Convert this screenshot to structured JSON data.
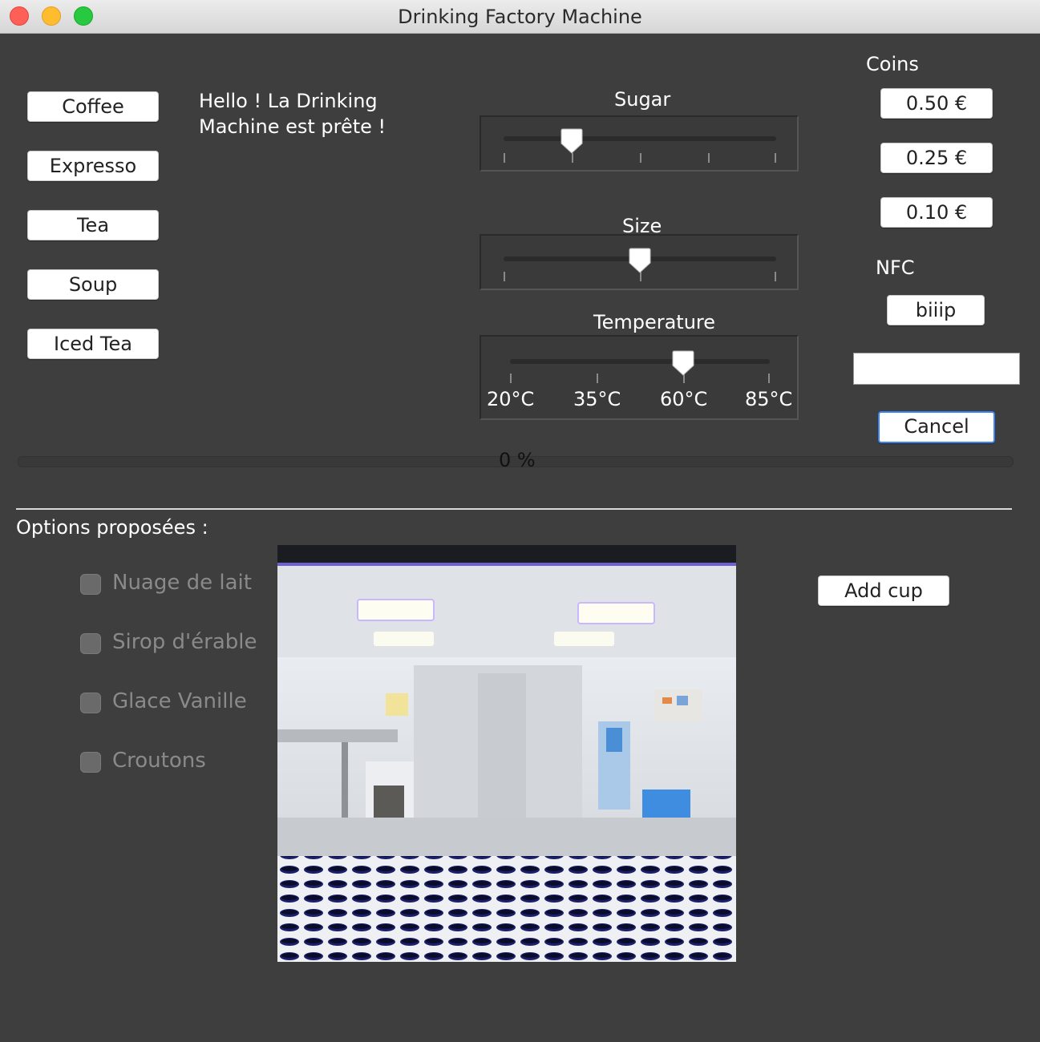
{
  "window": {
    "title": "Drinking Factory Machine"
  },
  "drinks": [
    {
      "label": "Coffee"
    },
    {
      "label": "Expresso"
    },
    {
      "label": "Tea"
    },
    {
      "label": "Soup"
    },
    {
      "label": "Iced Tea"
    }
  ],
  "message": {
    "line1": "Hello ! La Drinking",
    "line2": "Machine est prête !"
  },
  "sliders": {
    "sugar": {
      "label": "Sugar",
      "value": 1,
      "max": 4
    },
    "size": {
      "label": "Size",
      "value": 1,
      "max": 2
    },
    "temperature": {
      "label": "Temperature",
      "value": 2,
      "max": 3,
      "ticks": [
        "20°C",
        "35°C",
        "60°C",
        "85°C"
      ]
    }
  },
  "coins": {
    "label": "Coins",
    "buttons": [
      {
        "label": "0.50 €"
      },
      {
        "label": "0.25 €"
      },
      {
        "label": "0.10 €"
      }
    ]
  },
  "nfc": {
    "label": "NFC",
    "button": "biiip",
    "input_value": ""
  },
  "cancel": {
    "label": "Cancel"
  },
  "progress": {
    "value": 0,
    "text": "0 %"
  },
  "options": {
    "title": "Options proposées :",
    "items": [
      {
        "label": "Nuage de lait",
        "checked": false,
        "enabled": false
      },
      {
        "label": "Sirop d'érable",
        "checked": false,
        "enabled": false
      },
      {
        "label": "Glace Vanille",
        "checked": false,
        "enabled": false
      },
      {
        "label": "Croutons",
        "checked": false,
        "enabled": false
      }
    ]
  },
  "add_cup": {
    "label": "Add cup"
  },
  "colors": {
    "background": "#3e3e3e",
    "accent": "#4a90e2",
    "focus_border": "#3b82f6"
  }
}
